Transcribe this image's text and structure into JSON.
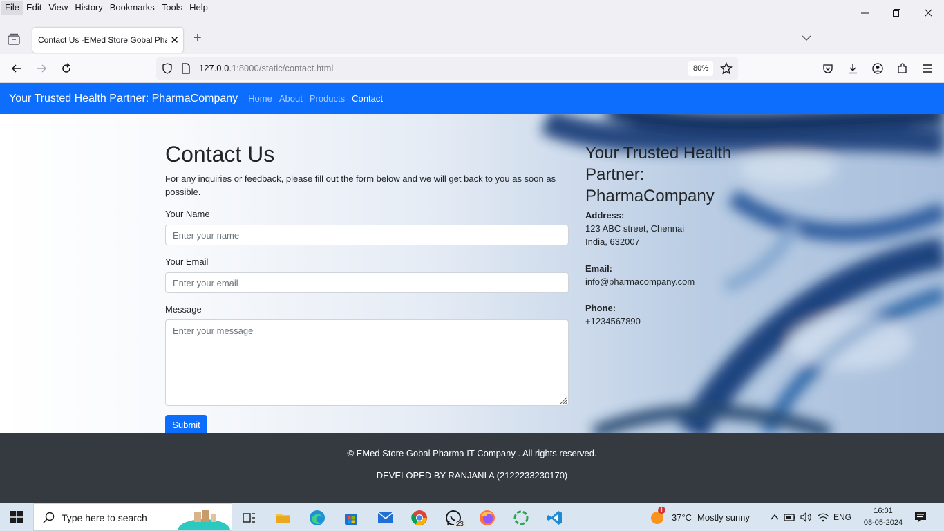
{
  "menubar": {
    "items": [
      "File",
      "Edit",
      "View",
      "History",
      "Bookmarks",
      "Tools",
      "Help"
    ]
  },
  "browser": {
    "tab_title": "Contact Us -EMed Store Gobal Pharma",
    "url_host": "127.0.0.1",
    "url_rest": ":8000/static/contact.html",
    "zoom": "80%"
  },
  "site": {
    "brand": "Your Trusted Health Partner: PharmaCompany",
    "nav": [
      "Home",
      "About",
      "Products",
      "Contact"
    ],
    "active_nav": "Contact"
  },
  "form": {
    "heading": "Contact Us",
    "lead": "For any inquiries or feedback, please fill out the form below and we will get back to you as soon as possible.",
    "name_label": "Your Name",
    "name_placeholder": "Enter your name",
    "email_label": "Your Email",
    "email_placeholder": "Enter your email",
    "message_label": "Message",
    "message_placeholder": "Enter your message",
    "submit_label": "Submit"
  },
  "info": {
    "heading": "Your Trusted Health Partner: PharmaCompany",
    "address_label": "Address:",
    "address_line1": "123 ABC street, Chennai",
    "address_line2": "India, 632007",
    "email_label": "Email:",
    "email_value": "info@pharmacompany.com",
    "phone_label": "Phone:",
    "phone_value": "+1234567890"
  },
  "footer": {
    "copyright": "© EMed Store Gobal Pharma IT Company . All rights reserved.",
    "developer": "DEVELOPED BY RANJANI A (2122233230170)"
  },
  "taskbar": {
    "search_placeholder": "Type here to search",
    "whatsapp_badge": "23",
    "weather_badge": "1",
    "temperature": "37°C",
    "weather": "Mostly sunny",
    "language": "ENG",
    "time": "16:01",
    "date": "08-05-2024"
  },
  "colors": {
    "brand_blue": "#0d6efd",
    "footer_dark": "#343a40",
    "taskbar": "#d9e6f2"
  }
}
